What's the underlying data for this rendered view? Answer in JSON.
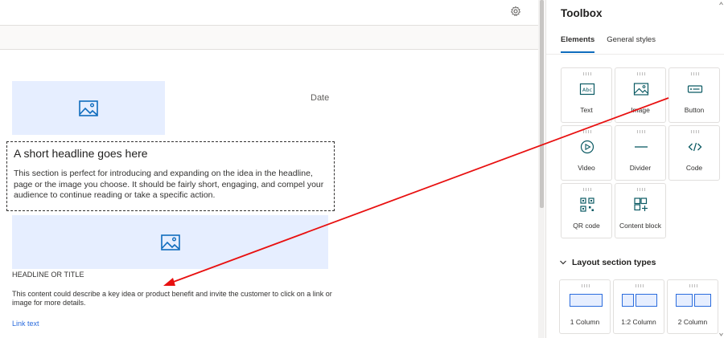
{
  "canvas": {
    "date_label": "Date",
    "headline": "A short headline goes here",
    "body_text": "This section is perfect for introducing and expanding on the idea in the headline, page or the image you choose. It should be fairly short, engaging, and compel your audience to continue reading or take a specific action.",
    "headline_title": "HEADLINE OR TITLE",
    "content_text": "This content could describe a key idea or product benefit and invite the customer to click on a link or image for more details.",
    "link_text": "Link text"
  },
  "toolbox": {
    "title": "Toolbox",
    "tabs": [
      {
        "label": "Elements",
        "active": true
      },
      {
        "label": "General styles",
        "active": false
      }
    ],
    "elements": [
      {
        "label": "Text",
        "icon": "text-icon"
      },
      {
        "label": "Image",
        "icon": "image-icon"
      },
      {
        "label": "Button",
        "icon": "button-icon"
      },
      {
        "label": "Video",
        "icon": "video-icon"
      },
      {
        "label": "Divider",
        "icon": "divider-icon"
      },
      {
        "label": "Code",
        "icon": "code-icon"
      },
      {
        "label": "QR code",
        "icon": "qr-code-icon"
      },
      {
        "label": "Content block",
        "icon": "content-block-icon"
      }
    ],
    "layout_section_title": "Layout section types",
    "layouts": [
      {
        "label": "1 Column"
      },
      {
        "label": "1:2 Column"
      },
      {
        "label": "2 Column"
      }
    ]
  },
  "colors": {
    "accent": "#0f6cbd",
    "image_placeholder": "#e6eeff",
    "icon_teal": "#0b5a63",
    "link": "#2b6cdd",
    "annotation_arrow": "#e81010"
  }
}
